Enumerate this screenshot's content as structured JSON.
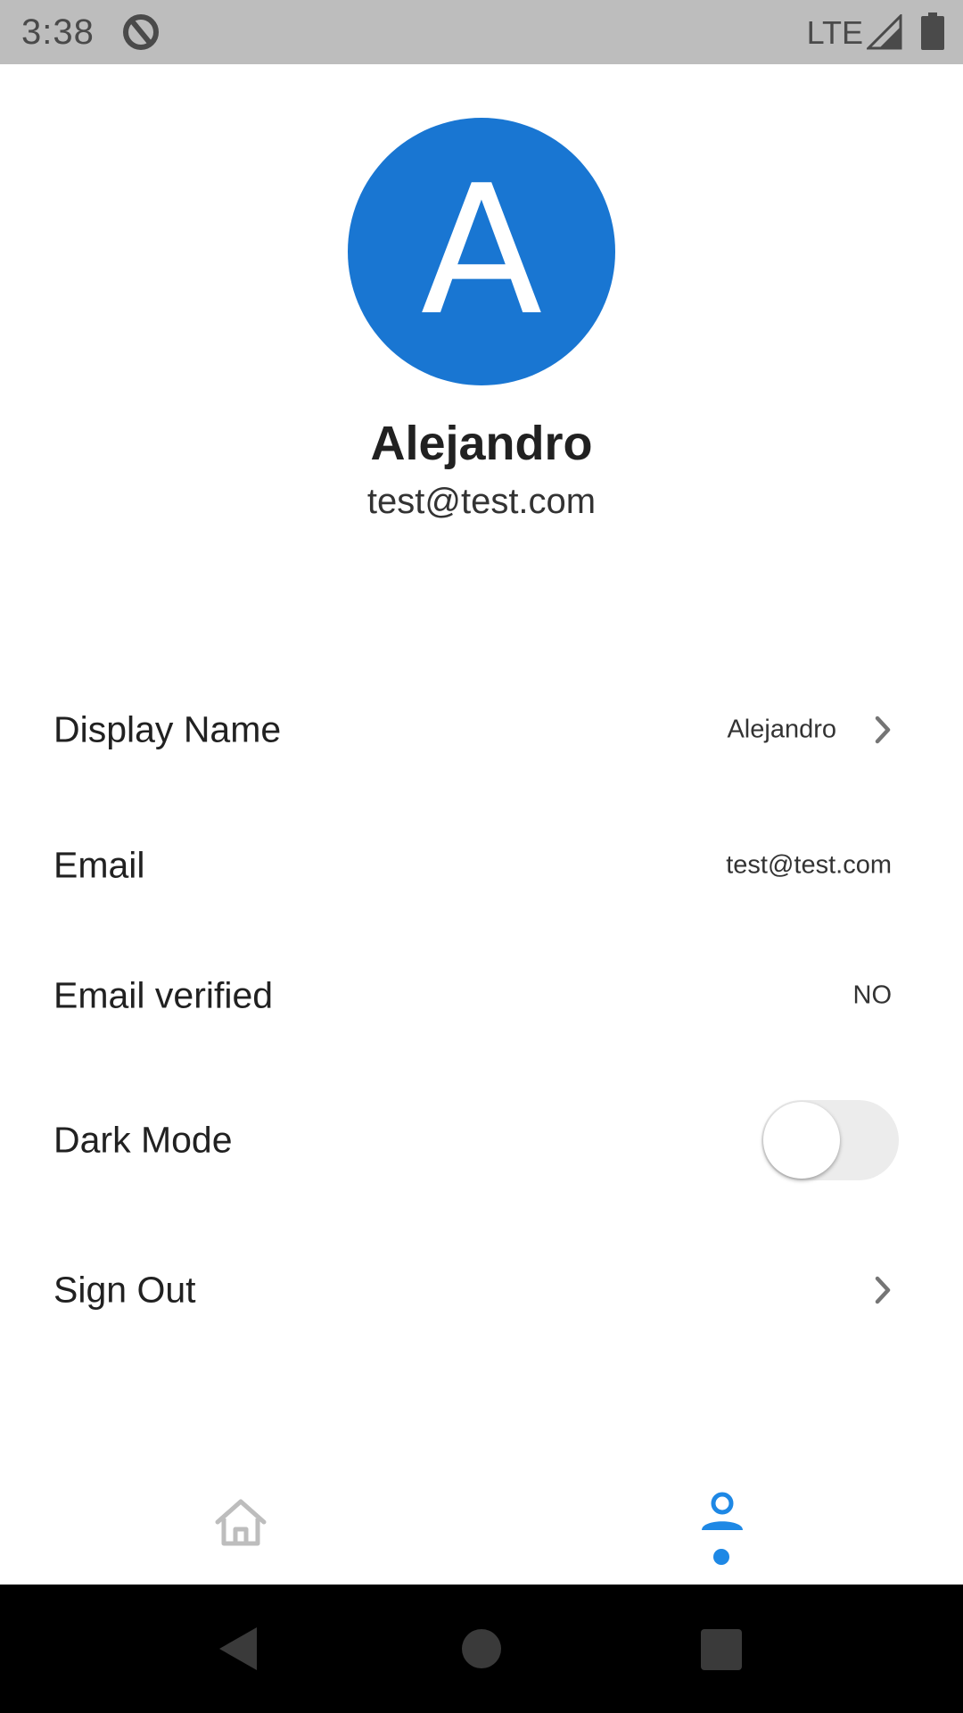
{
  "status_bar": {
    "time": "3:38",
    "network": "LTE",
    "icons": [
      "app-notification-icon",
      "signal-icon",
      "battery-icon"
    ]
  },
  "profile": {
    "avatar_initial": "A",
    "avatar_color": "#1976d2",
    "name": "Alejandro",
    "email": "test@test.com"
  },
  "settings": {
    "display_name": {
      "label": "Display Name",
      "value": "Alejandro"
    },
    "email": {
      "label": "Email",
      "value": "test@test.com"
    },
    "email_verified": {
      "label": "Email verified",
      "value": "NO"
    },
    "dark_mode": {
      "label": "Dark Mode",
      "enabled": false
    },
    "sign_out": {
      "label": "Sign Out"
    }
  },
  "tab_bar": {
    "tabs": [
      {
        "icon": "home-icon",
        "active": false
      },
      {
        "icon": "profile-icon",
        "active": true
      }
    ],
    "active_color": "#1e88e5",
    "inactive_color": "#bdbdbd"
  },
  "nav_bar": {
    "icons": [
      "back-icon",
      "home-circle-icon",
      "recents-icon"
    ]
  }
}
